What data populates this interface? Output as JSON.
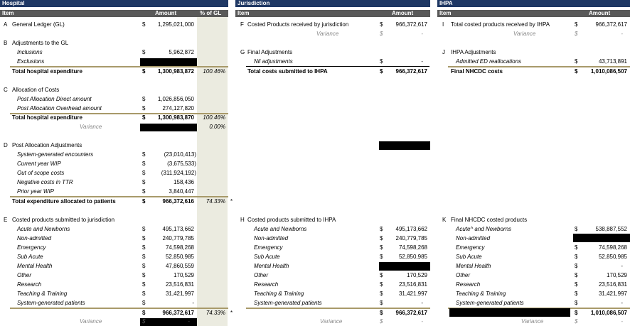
{
  "hospital": {
    "title": "Hospital",
    "cols": {
      "item": "Item",
      "amount": "Amount",
      "pct": "% of GL"
    },
    "A": {
      "letter": "A",
      "label": "General Ledger (GL)",
      "amount": "1,295,021,000"
    },
    "B": {
      "letter": "B",
      "label": "Adjustments to the GL",
      "items": [
        {
          "label": "Inclusions",
          "amount": "5,962,872"
        },
        {
          "label": "Exclusions",
          "amount": ""
        }
      ],
      "total": {
        "label": "Total hospital expenditure",
        "amount": "1,300,983,872",
        "pct": "100.46%"
      }
    },
    "C": {
      "letter": "C",
      "label": "Allocation of Costs",
      "items": [
        {
          "label": "Post Allocation Direct amount",
          "amount": "1,026,856,050"
        },
        {
          "label": "Post Allocation Overhead amount",
          "amount": "274,127,820"
        }
      ],
      "total": {
        "label": "Total hospital expenditure",
        "amount": "1,300,983,870",
        "pct": "100.46%"
      },
      "variance": {
        "label": "Variance",
        "pct": "0.00%"
      }
    },
    "D": {
      "letter": "D",
      "label": "Post Allocation Adjustments",
      "items": [
        {
          "label": "System-generated encounters",
          "amount": "(23,010,413)"
        },
        {
          "label": "Current year WIP",
          "amount": "(3,675,533)"
        },
        {
          "label": "Out of scope costs",
          "amount": "(311,924,192)"
        },
        {
          "label": "Negative costs in TTR",
          "amount": "158,436"
        },
        {
          "label": "Prior year WIP",
          "amount": "3,840,447"
        }
      ],
      "total": {
        "label": "Total expenditure allocated to patients",
        "amount": "966,372,616",
        "pct": "74.33%",
        "note": "*"
      }
    },
    "E": {
      "letter": "E",
      "label": "Costed products submitted to jurisdiction",
      "items": [
        {
          "label": "Acute and Newborns",
          "amount": "495,173,662"
        },
        {
          "label": "Non-admitted",
          "amount": "240,779,785"
        },
        {
          "label": "Emergency",
          "amount": "74,598,268"
        },
        {
          "label": "Sub Acute",
          "amount": "52,850,985"
        },
        {
          "label": "Mental Health",
          "amount": "47,860,559"
        },
        {
          "label": "Other",
          "amount": "170,529"
        },
        {
          "label": "Research",
          "amount": "23,516,831"
        },
        {
          "label": "Teaching & Training",
          "amount": "31,421,997"
        },
        {
          "label": "System-generated patients",
          "amount": "-"
        }
      ],
      "total": {
        "amount": "966,372,617",
        "pct": "74.33%",
        "note": "*"
      },
      "variance": {
        "label": "Variance",
        "dollar": "$",
        "amount": "-"
      }
    }
  },
  "jurisdiction": {
    "title": "Jurisdiction",
    "cols": {
      "item": "Item",
      "amount": "Amount"
    },
    "F": {
      "letter": "F",
      "label": "Costed Products received by jurisdiction",
      "amount": "966,372,617",
      "variance": {
        "label": "Variance",
        "dollar": "$",
        "amount": "-"
      }
    },
    "G": {
      "letter": "G",
      "label": "Final Adjustments",
      "items": [
        {
          "label": "Nil adjustments",
          "amount": "-"
        }
      ],
      "total": {
        "label": "Total costs submitted to IHPA",
        "amount": "966,372,617"
      }
    },
    "H": {
      "letter": "H",
      "label": "Costed products submitted to IHPA",
      "items": [
        {
          "label": "Acute and Newborns",
          "amount": "495,173,662"
        },
        {
          "label": "Non-admitted",
          "amount": "240,779,785"
        },
        {
          "label": "Emergency",
          "amount": "74,598,268"
        },
        {
          "label": "Sub Acute",
          "amount": "52,850,985"
        },
        {
          "label": "Mental Health",
          "amount": ""
        },
        {
          "label": "Other",
          "amount": "170,529"
        },
        {
          "label": "Research",
          "amount": "23,516,831"
        },
        {
          "label": "Teaching & Training",
          "amount": "31,421,997"
        },
        {
          "label": "System-generated patients",
          "amount": "-"
        }
      ],
      "total": {
        "amount": "966,372,617"
      },
      "variance": {
        "label": "Variance",
        "dollar": "$",
        "amount": "-"
      }
    }
  },
  "ihpa": {
    "title": "IHPA",
    "cols": {
      "item": "Item",
      "amount": "Amount"
    },
    "I": {
      "letter": "I",
      "label": "Total costed products received by IHPA",
      "amount": "966,372,617",
      "variance": {
        "label": "Variance",
        "dollar": "$",
        "amount": "-"
      }
    },
    "J": {
      "letter": "J",
      "label": "IHPA Adjustments",
      "items": [
        {
          "label": "Admitted ED reallocations",
          "amount": "43,713,891"
        }
      ],
      "total": {
        "label": "Final NHCDC costs",
        "amount": "1,010,086,507"
      }
    },
    "K": {
      "letter": "K",
      "label": "Final NHCDC costed products",
      "items": [
        {
          "label": "Acute^ and Newborns",
          "amount": "538,887,552"
        },
        {
          "label": "Non-admitted",
          "amount": ""
        },
        {
          "label": "Emergency",
          "amount": "74,598,268"
        },
        {
          "label": "Sub Acute",
          "amount": "52,850,985"
        },
        {
          "label": "Mental Health",
          "amount": "-"
        },
        {
          "label": "Other",
          "amount": "170,529"
        },
        {
          "label": "Research",
          "amount": "23,516,831"
        },
        {
          "label": "Teaching & Training",
          "amount": "31,421,997"
        },
        {
          "label": "System-generated patients",
          "amount": "-"
        }
      ],
      "total": {
        "amount": "1,010,086,507"
      },
      "variance": {
        "label": "Variance",
        "dollar": "$",
        "amount": "-"
      }
    }
  },
  "dollar": "$",
  "colors": {
    "header": "#1f3864",
    "subheader": "#595959",
    "pct_column": "#ebebe0",
    "total_rule": "#a89a6a"
  }
}
